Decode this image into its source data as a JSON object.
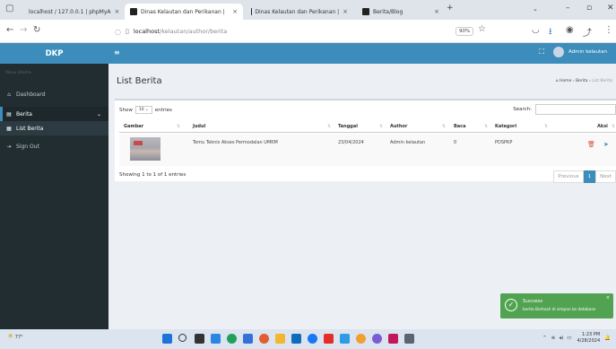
{
  "browser": {
    "tabs": [
      {
        "label": "localhost / 127.0.0.1 | phpMyA",
        "close": "×",
        "color": "#e8a43d"
      },
      {
        "label": "Dinas Kelautan dan Perikanan |",
        "close": "×",
        "color": "#222222"
      },
      {
        "label": "Dinas Kelautan dan Perikanan |",
        "close": "×",
        "color": "#222222"
      },
      {
        "label": "Berita/Blog",
        "close": "×",
        "color": "#222222"
      }
    ],
    "new_tab": "+",
    "url_host": "localhost",
    "url_path": "/kelautan/author/berita",
    "zoom": "90%"
  },
  "app": {
    "brand": "DKP",
    "user_name": "Admin kelautan"
  },
  "sidebar": {
    "header": "Menu Utama",
    "items": [
      {
        "label": "Dashboard",
        "icon": "dashboard-icon"
      },
      {
        "label": "Berita",
        "icon": "news-icon",
        "caret": "⌄"
      },
      {
        "label": "List Berita",
        "icon": "list-icon"
      },
      {
        "label": "Sign Out",
        "icon": "sign-out-icon"
      }
    ]
  },
  "page": {
    "title": "List Berita",
    "breadcrumb": [
      "Home",
      "Berita",
      "List Berita"
    ]
  },
  "table": {
    "show_label": "Show",
    "page_size": "10",
    "entries_label": "entries",
    "search_label": "Search:",
    "columns": [
      "Gambar",
      "Judul",
      "Tanggal",
      "Author",
      "Baca",
      "Kategori",
      "Aksi"
    ],
    "rows": [
      {
        "judul": "Temu Teknis Akses Permodalan UMKM",
        "tanggal": "23/04/2024",
        "author": "Admin kelautan",
        "baca": "0",
        "kategori": "PDSPKP"
      }
    ],
    "info": "Showing 1 to 1 of 1 entries",
    "pager": {
      "previous": "Previous",
      "current": "1",
      "next": "Next"
    }
  },
  "toast": {
    "title": "Success",
    "message": "berita Berhasil di simpan ke database",
    "close": "×"
  },
  "taskbar": {
    "weather": "77°",
    "time": "1:23 PM",
    "date": "4/28/2024"
  },
  "colors": {
    "accent": "#3c8dbc",
    "sidebar": "#222d32",
    "success": "#51a351",
    "delete": "#dd4b39"
  }
}
